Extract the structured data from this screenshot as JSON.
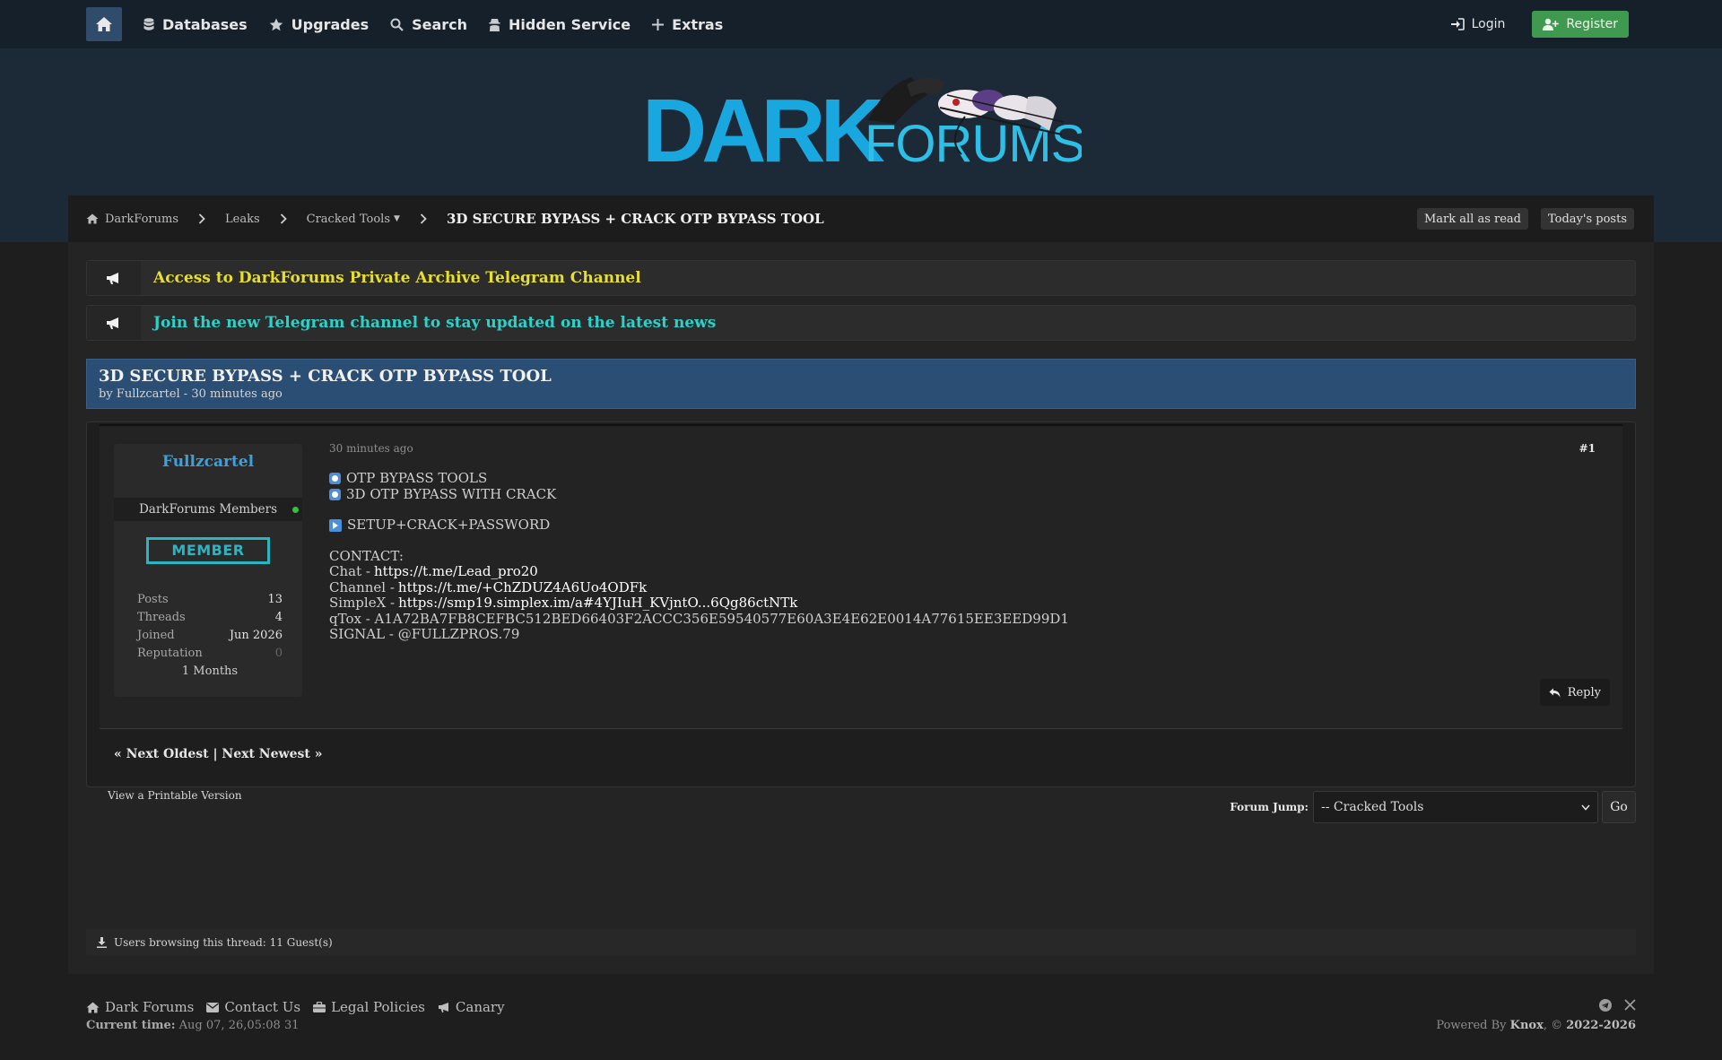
{
  "nav": {
    "items": [
      {
        "label": "Databases",
        "icon": "database-icon"
      },
      {
        "label": "Upgrades",
        "icon": "star-icon"
      },
      {
        "label": "Search",
        "icon": "search-icon"
      },
      {
        "label": "Hidden Service",
        "icon": "spy-icon"
      },
      {
        "label": "Extras",
        "icon": "plus-icon"
      }
    ],
    "login": "Login",
    "register": "Register"
  },
  "logo": {
    "dark": "DARK",
    "forums": "FORUMS"
  },
  "breadcrumb": {
    "home": "DarkForums",
    "leaks": "Leaks",
    "cracked_tools": "Cracked Tools",
    "cracked_tools_suffix": "▼",
    "current": "3D SECURE BYPASS + CRACK OTP BYPASS TOOL",
    "mark_read": "Mark all as read",
    "todays_posts": "Today's posts"
  },
  "announcements": [
    {
      "text": "Access to DarkForums Private Archive Telegram Channel",
      "color": "#e6df2e"
    },
    {
      "text": "Join the new Telegram channel to stay updated on the latest news",
      "color": "#2fd0c8"
    }
  ],
  "thread": {
    "title": "3D SECURE BYPASS + CRACK OTP BYPASS TOOL",
    "by": "by Fullzcartel - 30 minutes ago"
  },
  "post": {
    "author": "Fullzcartel",
    "group": "DarkForums Members",
    "badge": "MEMBER",
    "stats": [
      {
        "k": "Posts",
        "v": "13"
      },
      {
        "k": "Threads",
        "v": "4"
      },
      {
        "k": "Joined",
        "v": "Jun 2026"
      },
      {
        "k": "Reputation",
        "v": "0"
      }
    ],
    "months": "1 Months",
    "date": "30 minutes ago",
    "number": "#1",
    "lines": {
      "l1": "OTP BYPASS TOOLS",
      "l2": "3D OTP BYPASS WITH CRACK",
      "l3": "SETUP+CRACK+PASSWORD",
      "contact": "CONTACT:",
      "chat_label": "Chat -",
      "chat_link": "https://t.me/Lead_pro20",
      "channel_label": "Channel -",
      "channel_link": "https://t.me/+ChZDUZ4A6Uo4ODFk",
      "simplex_label": "SimpleX -",
      "simplex_link": "https://smp19.simplex.im/a#4YJIuH_KVjntO...6Qg86ctNTk",
      "qtox": "qTox - A1A72BA7FB8CEFBC512BED66403F2ACCC356E59540577E60A3E4E62E0014A77615EE3EED99D1",
      "signal": "SIGNAL - @FULLZPROS.79"
    },
    "reply": "Reply"
  },
  "pager": "« Next Oldest | Next Newest »",
  "printable": "View a Printable Version",
  "forum_jump": {
    "label": "Forum Jump:",
    "selected": "-- Cracked Tools",
    "go": "Go"
  },
  "browsing": "Users browsing this thread: 11 Guest(s)",
  "footer": {
    "links": [
      "Dark Forums",
      "Contact Us",
      "Legal Policies",
      "Canary"
    ],
    "current_time_label": "Current time:",
    "current_time": "Aug 07, 26,05:08 31",
    "powered_prefix": "Powered By",
    "powered_name": "Knox",
    "powered_suffix": ", ©",
    "years": "2022-2026"
  }
}
